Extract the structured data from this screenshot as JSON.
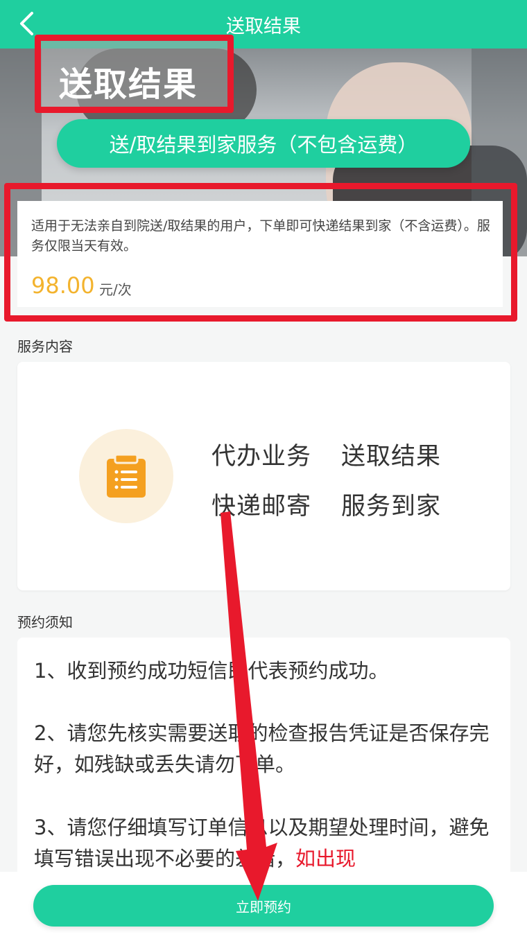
{
  "header": {
    "title": "送取结果",
    "back_icon": "chevron-left-icon"
  },
  "hero": {
    "title": "送取结果",
    "service_button": "送/取结果到家服务（不包含运费）"
  },
  "info": {
    "description": "适用于无法亲自到院送/取结果的用户，下单即可快递结果到家（不含运费）。服务仅限当天有效。",
    "price": "98.00",
    "unit": "元/次"
  },
  "service_section": {
    "title": "服务内容",
    "icon": "clipboard-list-icon",
    "tags": [
      "代办业务",
      "送取结果",
      "快递邮寄",
      "服务到家"
    ]
  },
  "notice_section": {
    "title": "预约须知",
    "items": [
      "1、收到预约成功短信即代表预约成功。",
      "2、请您先核实需要送取的检查报告凭证是否保存完好，如残缺或丢失请勿下单。",
      "3、请您仔细填写订单信息以及期望处理时间，避免填写错误出现不必要的差错，"
    ],
    "item3_red": "如出现"
  },
  "footer": {
    "book_button": "立即预约"
  },
  "colors": {
    "brand_green": "#1fcf9f",
    "price": "#f3b32e",
    "annotation_red": "#e8192c"
  }
}
